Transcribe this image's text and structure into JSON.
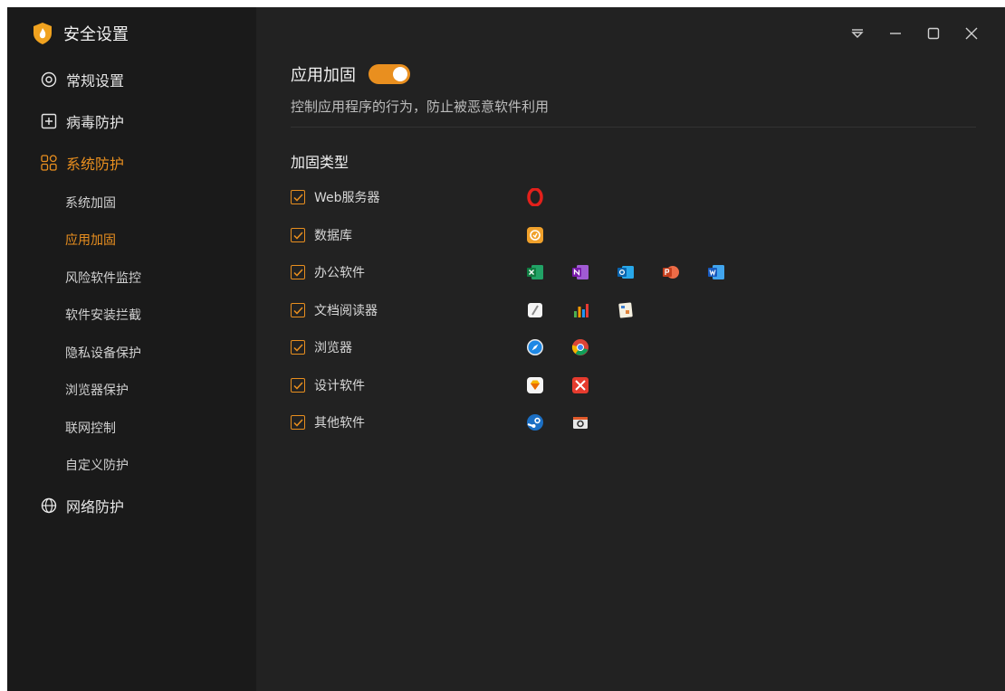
{
  "app": {
    "title": "安全设置"
  },
  "sidebar": {
    "items": [
      {
        "label": "常规设置",
        "icon": "gear-icon"
      },
      {
        "label": "病毒防护",
        "icon": "plus-box-icon"
      },
      {
        "label": "系统防护",
        "icon": "grid-icon",
        "active": true
      },
      {
        "label": "网络防护",
        "icon": "globe-icon"
      }
    ],
    "sub_items": [
      {
        "label": "系统加固"
      },
      {
        "label": "应用加固",
        "active": true
      },
      {
        "label": "风险软件监控"
      },
      {
        "label": "软件安装拦截"
      },
      {
        "label": "隐私设备保护"
      },
      {
        "label": "浏览器保护"
      },
      {
        "label": "联网控制"
      },
      {
        "label": "自定义防护"
      }
    ]
  },
  "main": {
    "title": "应用加固",
    "toggle_on": true,
    "description": "控制应用程序的行为，防止被恶意软件利用",
    "group_title": "加固类型",
    "rows": [
      {
        "label": "Web服务器",
        "checked": true,
        "apps": [
          "opera-icon"
        ]
      },
      {
        "label": "数据库",
        "checked": true,
        "apps": [
          "database-app-icon"
        ]
      },
      {
        "label": "办公软件",
        "checked": true,
        "apps": [
          "excel-icon",
          "onenote-icon",
          "outlook-icon",
          "powerpoint-icon",
          "word-icon"
        ]
      },
      {
        "label": "文档阅读器",
        "checked": true,
        "apps": [
          "notes-icon",
          "chart-app-icon",
          "document-app-icon"
        ]
      },
      {
        "label": "浏览器",
        "checked": true,
        "apps": [
          "safari-icon",
          "chrome-icon"
        ]
      },
      {
        "label": "设计软件",
        "checked": true,
        "apps": [
          "sketch-icon",
          "xmind-icon"
        ]
      },
      {
        "label": "其他软件",
        "checked": true,
        "apps": [
          "steam-icon",
          "camera-app-icon"
        ]
      }
    ]
  },
  "colors": {
    "accent": "#e98f1f",
    "background": "#222222",
    "sidebar": "#1a1a1a"
  }
}
